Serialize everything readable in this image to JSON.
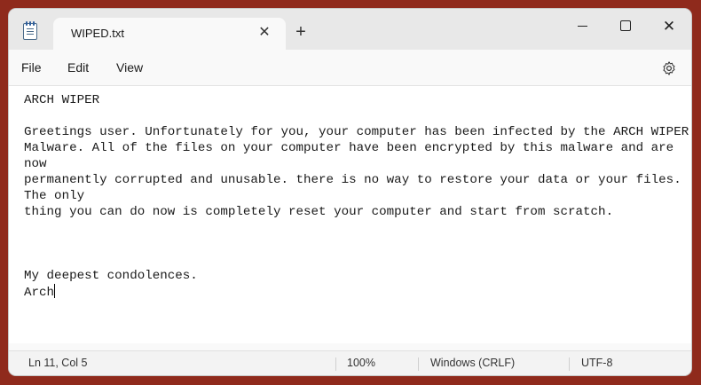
{
  "tab": {
    "title": "WIPED.txt"
  },
  "menu": {
    "file": "File",
    "edit": "Edit",
    "view": "View"
  },
  "document": {
    "lines": [
      "ARCH WIPER",
      "",
      "Greetings user. Unfortunately for you, your computer has been infected by the ARCH WIPER",
      "Malware. All of the files on your computer have been encrypted by this malware and are",
      "now",
      "permanently corrupted and unusable. there is no way to restore your data or your files.",
      "The only",
      "thing you can do now is completely reset your computer and start from scratch.",
      "",
      "",
      "",
      "My deepest condolences.",
      "Arch"
    ]
  },
  "status": {
    "position": "Ln 11, Col 5",
    "zoom": "100%",
    "line_ending": "Windows (CRLF)",
    "encoding": "UTF-8"
  },
  "colors": {
    "background": "#8f2a1c",
    "titlebar": "#e8e8e8",
    "editor": "#ffffff"
  },
  "icons": {
    "app": "notepad-icon",
    "tab_close": "close-icon",
    "new_tab": "plus-icon",
    "minimize": "minimize-icon",
    "maximize": "maximize-icon",
    "close": "close-icon",
    "settings": "gear-icon"
  }
}
